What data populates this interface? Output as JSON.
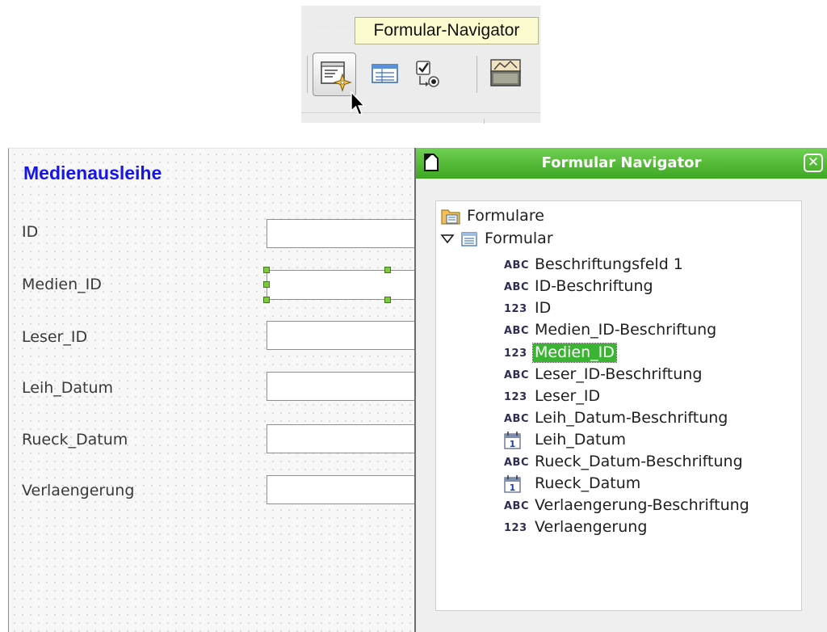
{
  "toolbar": {
    "tooltip": "Formular-Navigator",
    "buttons": [
      {
        "icon": "form-navigator-icon"
      },
      {
        "icon": "add-field-icon"
      },
      {
        "icon": "activation-order-icon"
      },
      {
        "icon": "open-in-design-icon"
      }
    ]
  },
  "form": {
    "title": "Medienausleihe",
    "fields": [
      {
        "label": "ID"
      },
      {
        "label": "Medien_ID",
        "selected": true
      },
      {
        "label": "Leser_ID"
      },
      {
        "label": "Leih_Datum"
      },
      {
        "label": "Rueck_Datum"
      },
      {
        "label": "Verlaengerung"
      }
    ]
  },
  "navigator": {
    "title": "Formular Navigator",
    "close_label": "✕",
    "root": "Formulare",
    "form_node": "Formular",
    "items": [
      {
        "tag": "ABC",
        "label": "Beschriftungsfeld 1",
        "icon": "label-control-icon"
      },
      {
        "tag": "ABC",
        "label": "ID-Beschriftung",
        "icon": "label-control-icon"
      },
      {
        "tag": "123",
        "label": "ID",
        "icon": "numeric-field-icon"
      },
      {
        "tag": "ABC",
        "label": "Medien_ID-Beschriftung",
        "icon": "label-control-icon"
      },
      {
        "tag": "123",
        "label": "Medien_ID",
        "icon": "numeric-field-icon",
        "selected": true
      },
      {
        "tag": "ABC",
        "label": "Leser_ID-Beschriftung",
        "icon": "label-control-icon"
      },
      {
        "tag": "123",
        "label": "Leser_ID",
        "icon": "numeric-field-icon"
      },
      {
        "tag": "ABC",
        "label": "Leih_Datum-Beschriftung",
        "icon": "label-control-icon"
      },
      {
        "tag": "",
        "label": "Leih_Datum",
        "icon": "date-field-icon"
      },
      {
        "tag": "ABC",
        "label": "Rueck_Datum-Beschriftung",
        "icon": "label-control-icon"
      },
      {
        "tag": "",
        "label": "Rueck_Datum",
        "icon": "date-field-icon"
      },
      {
        "tag": "ABC",
        "label": "Verlaengerung-Beschriftung",
        "icon": "label-control-icon"
      },
      {
        "tag": "123",
        "label": "Verlaengerung",
        "icon": "numeric-field-icon"
      }
    ]
  },
  "colors": {
    "title_blue": "#1515ea",
    "nav_green": "#3ea622",
    "selection_green": "#3cb433",
    "tooltip_yellow": "#fbfbcf"
  }
}
